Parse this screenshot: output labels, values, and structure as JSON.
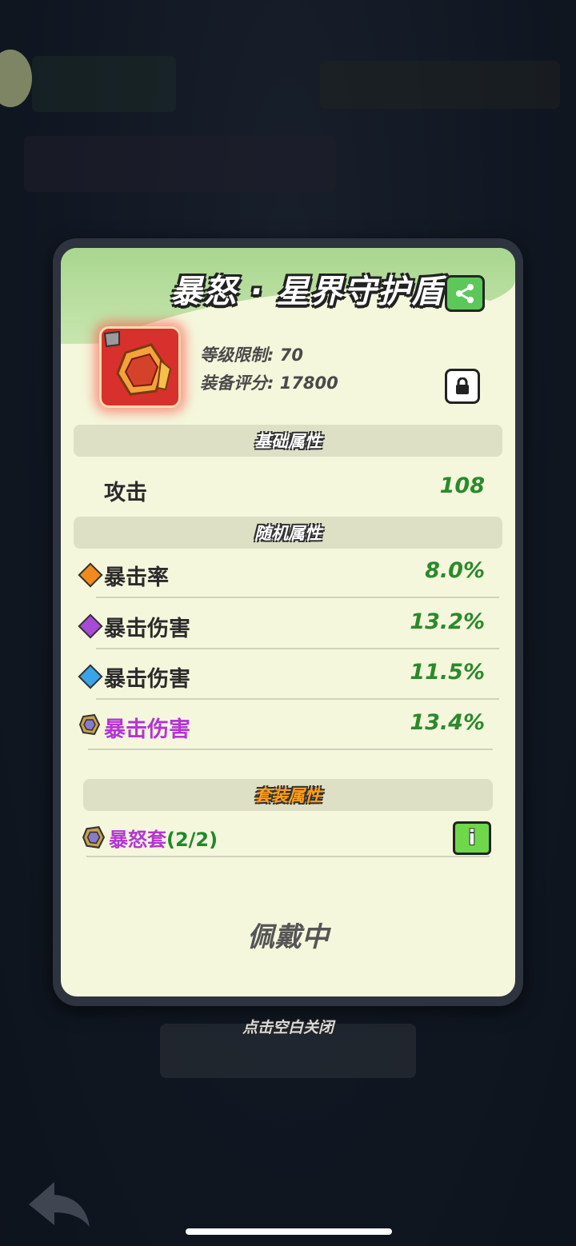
{
  "item": {
    "title": "暴怒 · 星界守护盾",
    "level_label": "等级限制: 70",
    "score_label": "装备评分: 17800"
  },
  "sections": {
    "base": "基础属性",
    "random": "随机属性",
    "set": "套装属性"
  },
  "base_attrs": [
    {
      "name": "攻击",
      "value": "108"
    }
  ],
  "random_attrs": [
    {
      "name": "暴击率",
      "value": "8.0%",
      "gem": "orange-gem-icon"
    },
    {
      "name": "暴击伤害",
      "value": "13.2%",
      "gem": "purple-gem-icon"
    },
    {
      "name": "暴击伤害",
      "value": "11.5%",
      "gem": "blue-gem-icon"
    },
    {
      "name": "暴击伤害",
      "value": "13.4%",
      "gem": "rage-set-icon"
    }
  ],
  "set": {
    "name": "暴怒套",
    "count": "(2/2)"
  },
  "status": "佩戴中",
  "close_hint": "点击空白关闭",
  "colors": {
    "card_bg": "#f4f7dc",
    "header_green": "#a9d68f",
    "value_green": "#2b8a2b",
    "set_purple": "#b534d6",
    "set_title_orange": "#ff9f1a"
  }
}
